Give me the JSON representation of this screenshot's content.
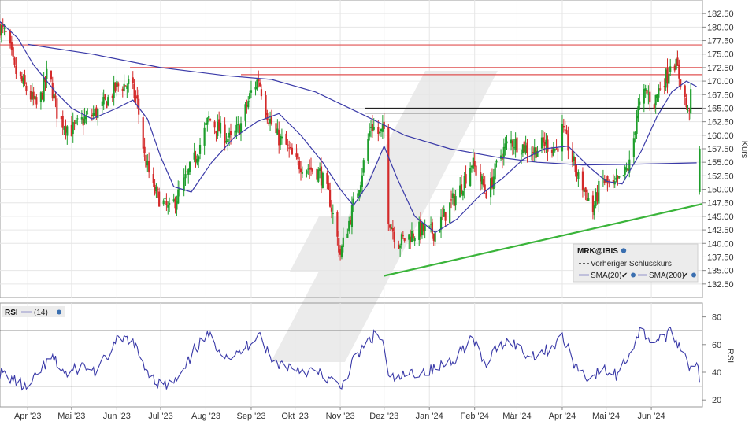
{
  "chart_data": [
    {
      "type": "candlestick",
      "ylabel": "Kurs",
      "ylim": [
        130.0,
        185.0
      ],
      "y_ticks": [
        132.5,
        135.0,
        137.5,
        140.0,
        142.5,
        145.0,
        147.5,
        150.0,
        152.5,
        155.0,
        157.5,
        160.0,
        162.5,
        165.0,
        167.5,
        170.0,
        172.5,
        175.0,
        177.5,
        180.0,
        182.5
      ],
      "y_tick_labels": [
        "132.50",
        "135.00",
        "137.50",
        "140.00",
        "142.50",
        "145.00",
        "147.50",
        "150.00",
        "152.50",
        "155.00",
        "157.50",
        "160.00",
        "162.50",
        "165.00",
        "167.50",
        "170.00",
        "172.50",
        "175.00",
        "177.50",
        "180.00",
        "182.50"
      ],
      "x_range": [
        "2023-03-13",
        "2024-07-06"
      ],
      "x_ticks": [
        "2023-04-01",
        "2023-05-01",
        "2023-06-01",
        "2023-07-01",
        "2023-08-01",
        "2023-09-01",
        "2023-10-01",
        "2023-11-01",
        "2023-12-01",
        "2024-01-01",
        "2024-02-01",
        "2024-03-01",
        "2024-04-01",
        "2024-05-01",
        "2024-06-01"
      ],
      "x_tick_labels": [
        "Apr '23",
        "Mai '23",
        "Jun '23",
        "Jul '23",
        "Aug '23",
        "Sep '23",
        "Okt '23",
        "Nov '23",
        "Dez '23",
        "Jan '24",
        "Feb '24",
        "Mär '24",
        "Apr '24",
        "Mai '24",
        "Jun '24"
      ],
      "grid": true,
      "legend": {
        "title": "MRK@IBIS",
        "entries": [
          "Vorheriger Schlusskurs",
          "SMA(20)",
          "SMA(200)"
        ],
        "placement": "bottom-right"
      },
      "colors": {
        "up": "#1e9e2c",
        "down": "#d42a2a",
        "sma": "#3a3aa8",
        "support": "#3ab43a",
        "resistance": "#e05050",
        "level": "#222222"
      },
      "close_path": [
        {
          "x": "2023-03-13",
          "y": 180.0
        },
        {
          "x": "2023-03-18",
          "y": 178.0
        },
        {
          "x": "2023-03-23",
          "y": 172.0
        },
        {
          "x": "2023-04-01",
          "y": 168.0
        },
        {
          "x": "2023-04-08",
          "y": 165.0
        },
        {
          "x": "2023-04-15",
          "y": 172.0
        },
        {
          "x": "2023-04-22",
          "y": 163.0
        },
        {
          "x": "2023-05-01",
          "y": 161.0
        },
        {
          "x": "2023-05-10",
          "y": 163.0
        },
        {
          "x": "2023-05-20",
          "y": 164.5
        },
        {
          "x": "2023-06-01",
          "y": 169.0
        },
        {
          "x": "2023-06-10",
          "y": 169.5
        },
        {
          "x": "2023-06-15",
          "y": 166.0
        },
        {
          "x": "2023-06-20",
          "y": 156.0
        },
        {
          "x": "2023-06-26",
          "y": 150.0
        },
        {
          "x": "2023-07-01",
          "y": 148.0
        },
        {
          "x": "2023-07-07",
          "y": 146.0
        },
        {
          "x": "2023-07-15",
          "y": 150.0
        },
        {
          "x": "2023-07-25",
          "y": 156.0
        },
        {
          "x": "2023-08-03",
          "y": 163.0
        },
        {
          "x": "2023-08-10",
          "y": 161.0
        },
        {
          "x": "2023-08-18",
          "y": 159.0
        },
        {
          "x": "2023-08-25",
          "y": 162.0
        },
        {
          "x": "2023-09-01",
          "y": 168.0
        },
        {
          "x": "2023-09-06",
          "y": 170.5
        },
        {
          "x": "2023-09-12",
          "y": 164.0
        },
        {
          "x": "2023-09-18",
          "y": 160.0
        },
        {
          "x": "2023-09-25",
          "y": 158.0
        },
        {
          "x": "2023-10-01",
          "y": 155.0
        },
        {
          "x": "2023-10-10",
          "y": 154.0
        },
        {
          "x": "2023-10-18",
          "y": 153.0
        },
        {
          "x": "2023-10-25",
          "y": 148.0
        },
        {
          "x": "2023-11-01",
          "y": 138.0
        },
        {
          "x": "2023-11-07",
          "y": 144.0
        },
        {
          "x": "2023-11-15",
          "y": 152.0
        },
        {
          "x": "2023-11-22",
          "y": 162.0
        },
        {
          "x": "2023-11-28",
          "y": 160.0
        },
        {
          "x": "2023-12-01",
          "y": 161.0
        },
        {
          "x": "2023-12-04",
          "y": 145.0
        },
        {
          "x": "2023-12-10",
          "y": 140.0
        },
        {
          "x": "2023-12-16",
          "y": 141.0
        },
        {
          "x": "2023-12-25",
          "y": 142.5
        },
        {
          "x": "2024-01-05",
          "y": 142.0
        },
        {
          "x": "2024-01-15",
          "y": 147.0
        },
        {
          "x": "2024-01-22",
          "y": 150.0
        },
        {
          "x": "2024-01-30",
          "y": 155.0
        },
        {
          "x": "2024-02-10",
          "y": 149.0
        },
        {
          "x": "2024-02-18",
          "y": 156.0
        },
        {
          "x": "2024-02-25",
          "y": 159.0
        },
        {
          "x": "2024-03-05",
          "y": 158.0
        },
        {
          "x": "2024-03-12",
          "y": 157.0
        },
        {
          "x": "2024-03-20",
          "y": 158.5
        },
        {
          "x": "2024-03-28",
          "y": 157.5
        },
        {
          "x": "2024-04-01",
          "y": 161.0
        },
        {
          "x": "2024-04-05",
          "y": 158.0
        },
        {
          "x": "2024-04-12",
          "y": 152.0
        },
        {
          "x": "2024-04-18",
          "y": 149.0
        },
        {
          "x": "2024-04-22",
          "y": 146.0
        },
        {
          "x": "2024-04-28",
          "y": 152.0
        },
        {
          "x": "2024-05-05",
          "y": 150.0
        },
        {
          "x": "2024-05-12",
          "y": 152.0
        },
        {
          "x": "2024-05-18",
          "y": 155.0
        },
        {
          "x": "2024-05-22",
          "y": 164.0
        },
        {
          "x": "2024-05-28",
          "y": 168.0
        },
        {
          "x": "2024-06-03",
          "y": 166.0
        },
        {
          "x": "2024-06-08",
          "y": 170.0
        },
        {
          "x": "2024-06-12",
          "y": 171.0
        },
        {
          "x": "2024-06-15",
          "y": 175.0
        },
        {
          "x": "2024-06-19",
          "y": 172.0
        },
        {
          "x": "2024-06-23",
          "y": 168.0
        },
        {
          "x": "2024-06-26",
          "y": 164.0
        },
        {
          "x": "2024-06-28",
          "y": 167.0
        }
      ],
      "sma20": [
        {
          "x": "2023-03-13",
          "y": 181.0
        },
        {
          "x": "2023-03-25",
          "y": 178.0
        },
        {
          "x": "2023-04-05",
          "y": 173.0
        },
        {
          "x": "2023-04-20",
          "y": 168.0
        },
        {
          "x": "2023-05-01",
          "y": 165.0
        },
        {
          "x": "2023-05-15",
          "y": 163.0
        },
        {
          "x": "2023-06-01",
          "y": 165.0
        },
        {
          "x": "2023-06-12",
          "y": 166.5
        },
        {
          "x": "2023-06-22",
          "y": 163.0
        },
        {
          "x": "2023-07-01",
          "y": 156.0
        },
        {
          "x": "2023-07-10",
          "y": 150.5
        },
        {
          "x": "2023-07-22",
          "y": 149.5
        },
        {
          "x": "2023-08-05",
          "y": 155.0
        },
        {
          "x": "2023-08-20",
          "y": 159.5
        },
        {
          "x": "2023-09-05",
          "y": 162.5
        },
        {
          "x": "2023-09-20",
          "y": 164.0
        },
        {
          "x": "2023-10-05",
          "y": 160.0
        },
        {
          "x": "2023-10-20",
          "y": 155.0
        },
        {
          "x": "2023-11-01",
          "y": 150.0
        },
        {
          "x": "2023-11-10",
          "y": 147.0
        },
        {
          "x": "2023-11-20",
          "y": 151.0
        },
        {
          "x": "2023-12-01",
          "y": 158.0
        },
        {
          "x": "2023-12-10",
          "y": 152.0
        },
        {
          "x": "2023-12-22",
          "y": 145.0
        },
        {
          "x": "2024-01-05",
          "y": 142.0
        },
        {
          "x": "2024-01-20",
          "y": 144.5
        },
        {
          "x": "2024-02-05",
          "y": 149.0
        },
        {
          "x": "2024-02-20",
          "y": 152.0
        },
        {
          "x": "2024-03-05",
          "y": 155.5
        },
        {
          "x": "2024-03-20",
          "y": 157.5
        },
        {
          "x": "2024-04-05",
          "y": 158.0
        },
        {
          "x": "2024-04-20",
          "y": 154.0
        },
        {
          "x": "2024-05-01",
          "y": 151.5
        },
        {
          "x": "2024-05-12",
          "y": 151.0
        },
        {
          "x": "2024-05-25",
          "y": 157.0
        },
        {
          "x": "2024-06-05",
          "y": 163.5
        },
        {
          "x": "2024-06-15",
          "y": 168.0
        },
        {
          "x": "2024-06-25",
          "y": 170.0
        },
        {
          "x": "2024-07-02",
          "y": 169.0
        }
      ],
      "sma200": [
        {
          "x": "2023-04-01",
          "y": 176.8
        },
        {
          "x": "2023-05-15",
          "y": 175.0
        },
        {
          "x": "2023-07-01",
          "y": 172.5
        },
        {
          "x": "2023-08-15",
          "y": 171.0
        },
        {
          "x": "2023-09-15",
          "y": 170.3
        },
        {
          "x": "2023-10-15",
          "y": 168.0
        },
        {
          "x": "2023-11-15",
          "y": 164.0
        },
        {
          "x": "2023-12-15",
          "y": 160.0
        },
        {
          "x": "2024-01-15",
          "y": 157.5
        },
        {
          "x": "2024-02-15",
          "y": 156.0
        },
        {
          "x": "2024-03-15",
          "y": 155.0
        },
        {
          "x": "2024-04-15",
          "y": 154.5
        },
        {
          "x": "2024-05-15",
          "y": 154.6
        },
        {
          "x": "2024-06-15",
          "y": 154.8
        },
        {
          "x": "2024-07-02",
          "y": 154.9
        }
      ],
      "horizontal_levels": [
        {
          "role": "resistance",
          "y": 176.7,
          "from": "2023-03-13",
          "to": "2024-07-06"
        },
        {
          "role": "resistance",
          "y": 172.5,
          "from": "2023-06-10",
          "to": "2024-07-06"
        },
        {
          "role": "resistance",
          "y": 171.2,
          "from": "2023-08-25",
          "to": "2024-07-06"
        },
        {
          "role": "level",
          "y": 165.0,
          "from": "2023-11-18",
          "to": "2024-07-06"
        },
        {
          "role": "level",
          "y": 164.1,
          "from": "2023-11-18",
          "to": "2024-07-06"
        }
      ],
      "trendline": [
        {
          "x": "2023-12-01",
          "y": 134.0
        },
        {
          "x": "2024-07-06",
          "y": 147.3
        }
      ],
      "last_bar": {
        "x": "2024-07-04",
        "open": 149.5,
        "high": 158.0,
        "low": 149.0,
        "close": 157.5
      }
    },
    {
      "type": "line",
      "title": "RSI",
      "legend": {
        "entries": [
          "(14)"
        ]
      },
      "ylabel": "RSI",
      "ylim": [
        15,
        90
      ],
      "y_ticks": [
        20,
        40,
        60,
        80
      ],
      "y_tick_labels": [
        "20",
        "40",
        "60",
        "80"
      ],
      "bands": [
        30,
        70
      ],
      "series": [
        {
          "values": [
            {
              "x": "2023-03-13",
              "y": 40
            },
            {
              "x": "2023-03-25",
              "y": 33
            },
            {
              "x": "2023-04-01",
              "y": 27
            },
            {
              "x": "2023-04-10",
              "y": 42
            },
            {
              "x": "2023-04-18",
              "y": 50
            },
            {
              "x": "2023-04-28",
              "y": 38
            },
            {
              "x": "2023-05-08",
              "y": 45
            },
            {
              "x": "2023-05-18",
              "y": 40
            },
            {
              "x": "2023-06-01",
              "y": 62
            },
            {
              "x": "2023-06-10",
              "y": 65
            },
            {
              "x": "2023-06-20",
              "y": 45
            },
            {
              "x": "2023-06-28",
              "y": 33
            },
            {
              "x": "2023-07-05",
              "y": 30
            },
            {
              "x": "2023-07-15",
              "y": 36
            },
            {
              "x": "2023-07-25",
              "y": 58
            },
            {
              "x": "2023-08-03",
              "y": 66
            },
            {
              "x": "2023-08-12",
              "y": 55
            },
            {
              "x": "2023-08-20",
              "y": 50
            },
            {
              "x": "2023-09-01",
              "y": 62
            },
            {
              "x": "2023-09-06",
              "y": 70
            },
            {
              "x": "2023-09-15",
              "y": 48
            },
            {
              "x": "2023-09-25",
              "y": 45
            },
            {
              "x": "2023-10-05",
              "y": 42
            },
            {
              "x": "2023-10-15",
              "y": 40
            },
            {
              "x": "2023-10-25",
              "y": 35
            },
            {
              "x": "2023-11-01",
              "y": 28
            },
            {
              "x": "2023-11-10",
              "y": 48
            },
            {
              "x": "2023-11-20",
              "y": 62
            },
            {
              "x": "2023-11-26",
              "y": 68
            },
            {
              "x": "2023-12-01",
              "y": 60
            },
            {
              "x": "2023-12-04",
              "y": 35
            },
            {
              "x": "2023-12-12",
              "y": 36
            },
            {
              "x": "2023-12-22",
              "y": 40
            },
            {
              "x": "2024-01-05",
              "y": 42
            },
            {
              "x": "2024-01-18",
              "y": 50
            },
            {
              "x": "2024-01-30",
              "y": 65
            },
            {
              "x": "2024-02-08",
              "y": 45
            },
            {
              "x": "2024-02-18",
              "y": 60
            },
            {
              "x": "2024-02-26",
              "y": 63
            },
            {
              "x": "2024-03-08",
              "y": 52
            },
            {
              "x": "2024-03-20",
              "y": 55
            },
            {
              "x": "2024-04-01",
              "y": 65
            },
            {
              "x": "2024-04-10",
              "y": 45
            },
            {
              "x": "2024-04-20",
              "y": 35
            },
            {
              "x": "2024-04-28",
              "y": 42
            },
            {
              "x": "2024-05-08",
              "y": 38
            },
            {
              "x": "2024-05-18",
              "y": 55
            },
            {
              "x": "2024-05-24",
              "y": 70
            },
            {
              "x": "2024-06-03",
              "y": 62
            },
            {
              "x": "2024-06-14",
              "y": 68
            },
            {
              "x": "2024-06-22",
              "y": 58
            },
            {
              "x": "2024-06-27",
              "y": 45
            },
            {
              "x": "2024-07-02",
              "y": 48
            },
            {
              "x": "2024-07-04",
              "y": 35
            }
          ]
        }
      ]
    }
  ]
}
